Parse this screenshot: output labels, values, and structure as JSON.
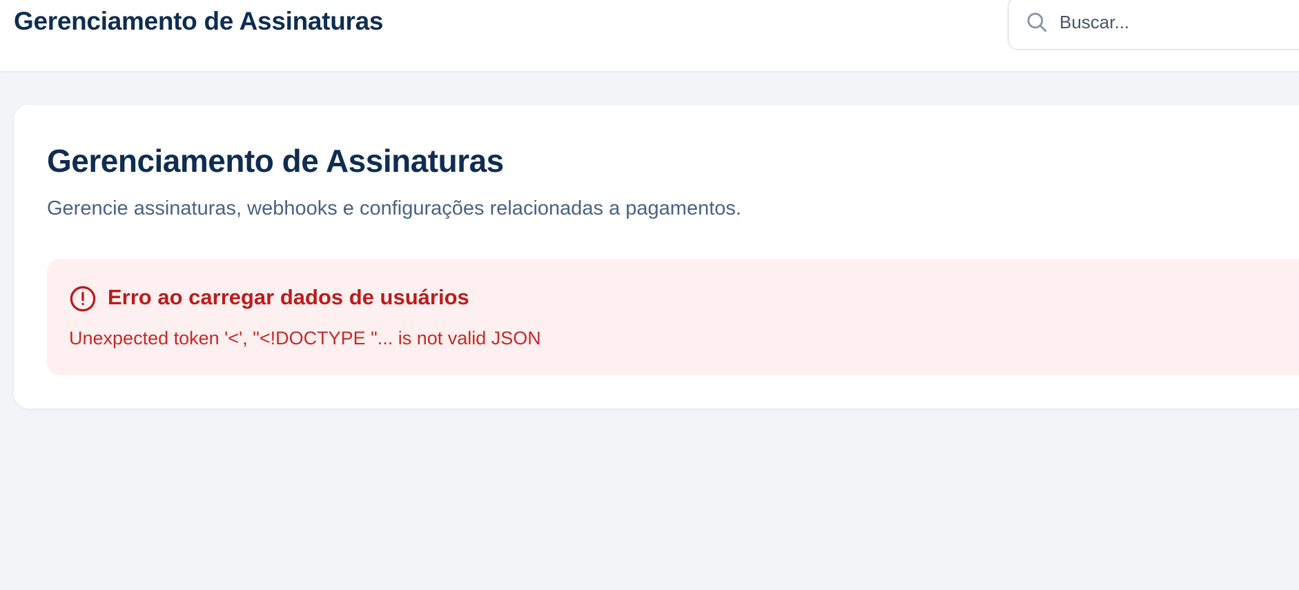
{
  "header": {
    "title": "Gerenciamento de Assinaturas",
    "search": {
      "placeholder": "Buscar...",
      "value": "",
      "icon": "search-icon"
    }
  },
  "main": {
    "title": "Gerenciamento de Assinaturas",
    "subtitle": "Gerencie assinaturas, webhooks e configurações relacionadas a pagamentos.",
    "error": {
      "icon": "alert-circle-icon",
      "title": "Erro ao carregar dados de usuários",
      "message": "Unexpected token '<', \"<!DOCTYPE \"... is not valid JSON"
    }
  },
  "colors": {
    "page_background": "#f3f4f6",
    "heading": "#0f2d52",
    "subtitle": "#4a6283",
    "error_background": "#fef0f0",
    "error_text": "#b91c1c"
  }
}
